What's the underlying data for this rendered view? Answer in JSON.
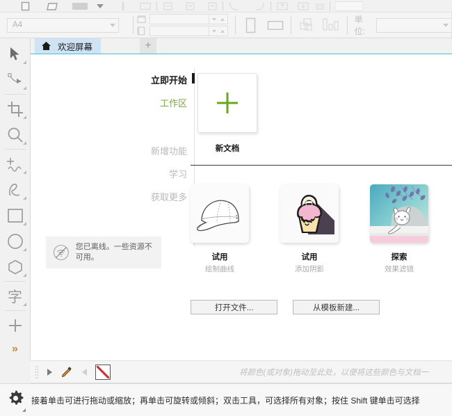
{
  "toolbar_top": {
    "icons": [
      {
        "name": "new-document-icon"
      },
      {
        "name": "open-document-icon"
      },
      {
        "name": "save-swatch-icon"
      },
      {
        "name": "dropdown-arrow-icon"
      },
      {
        "name": "print-icon"
      },
      {
        "name": "cut-icon"
      },
      {
        "name": "copy-icon"
      },
      {
        "name": "paste-icon"
      },
      {
        "name": "duplicate-icon"
      },
      {
        "name": "undo-arc-icon"
      },
      {
        "name": "redo-arc-icon"
      },
      {
        "name": "import-icon"
      },
      {
        "name": "export-icon"
      },
      {
        "name": "publish-pdf-icon"
      }
    ]
  },
  "toolbar_properties": {
    "page_size_value": "A4",
    "page_size_placeholder": "A4",
    "width_value": "",
    "height_value": "",
    "portrait_label": "portrait",
    "landscape_label": "landscape",
    "units_label": "单位:",
    "units_value": ""
  },
  "toolbox": {
    "tools": [
      {
        "name": "pick-tool",
        "label": "挑选工具"
      },
      {
        "name": "shape-tool",
        "label": "形状工具"
      },
      {
        "name": "crop-tool",
        "label": "裁剪工具"
      },
      {
        "name": "zoom-tool",
        "label": "缩放工具"
      },
      {
        "name": "freehand-tool",
        "label": "手绘工具"
      },
      {
        "name": "artistic-media-tool",
        "label": "艺术笔工具"
      },
      {
        "name": "rectangle-tool",
        "label": "矩形工具"
      },
      {
        "name": "ellipse-tool",
        "label": "椭圆形工具"
      },
      {
        "name": "polygon-tool",
        "label": "多边形工具"
      },
      {
        "name": "text-tool",
        "label": "字"
      },
      {
        "name": "parallel-dimension-tool",
        "label": "平行度量工具"
      },
      {
        "name": "more-tools",
        "label": "»"
      }
    ]
  },
  "tabs": {
    "active_tab_label": "欢迎屏幕",
    "home_icon": "home-icon",
    "new_tab_label": "+",
    "accent_color": "#3fc6d4",
    "active_tab_bg": "#cfe3f5"
  },
  "welcome": {
    "nav": [
      {
        "label": "立即开始",
        "state": "current"
      },
      {
        "label": "工作区",
        "state": "green"
      },
      {
        "label": "新增功能",
        "state": "muted"
      },
      {
        "label": "学习",
        "state": "muted"
      },
      {
        "label": "获取更多",
        "state": "muted"
      }
    ],
    "offline": {
      "icon": "wifi-off-icon",
      "message": "您已离线。一些资源不可用。"
    },
    "new_document": {
      "icon": "plus-icon",
      "label": "新文档",
      "accent_color": "#6aa521"
    },
    "cards": [
      {
        "title": "试用",
        "subtitle": "绘制曲线",
        "thumb": "cap-sketch-thumbnail"
      },
      {
        "title": "试用",
        "subtitle": "添加阴影",
        "thumb": "cupcake-thumbnail"
      },
      {
        "title": "探索",
        "subtitle": "效果滤镜",
        "thumb": "cat-illustration-thumbnail"
      }
    ],
    "buttons": [
      {
        "label": "打开文件...",
        "name": "open-file-button"
      },
      {
        "label": "从模板新建...",
        "name": "new-from-template-button"
      }
    ]
  },
  "palette_bar": {
    "no_color_swatch": "no-color-swatch",
    "eyedropper_icon": "eyedropper-icon",
    "scroll_left_icon": "chevron-left-icon",
    "scroll_right_icon": "play-right-icon",
    "drop_hint": "将颜色(或对象)拖动至此处，以便将这些颜色与文档一"
  },
  "status_bar": {
    "icon": "gear-icon",
    "message": "接着单击可进行拖动或缩放；再单击可旋转或倾斜；双击工具，可选择所有对象；按住 Shift 键单击可选择"
  }
}
